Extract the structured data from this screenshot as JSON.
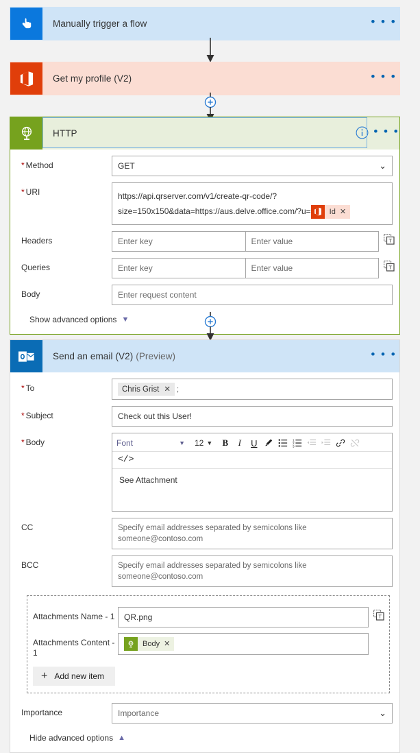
{
  "flow": {
    "trigger": {
      "title": "Manually trigger a flow",
      "icon": "hand-pointer-icon",
      "bg": "#cfe4f7",
      "icon_bg": "#0b78dd",
      "more_label": "• • •"
    },
    "profile": {
      "title": "Get my profile (V2)",
      "icon": "office365-icon",
      "bg": "#fbddd3",
      "icon_bg": "#e03e0a",
      "more_label": "• • •"
    },
    "http": {
      "title": "HTTP",
      "icon": "http-globe-icon",
      "accent": "#76a21e",
      "header_bg": "#e8efdc",
      "info_label": "i",
      "more_label": "• • •",
      "fields": {
        "method_label": "Method",
        "method_value": "GET",
        "uri_label": "URI",
        "uri_line1": "https://api.qrserver.com/v1/create-qr-code/?",
        "uri_line2": "size=150x150&data=https://aus.delve.office.com/?u=",
        "uri_token": "Id",
        "headers_label": "Headers",
        "queries_label": "Queries",
        "body_label": "Body",
        "key_placeholder": "Enter key",
        "value_placeholder": "Enter value",
        "body_placeholder": "Enter request content",
        "advanced_label": "Show advanced options"
      }
    },
    "email": {
      "title": "Send an email (V2)",
      "title_suffix": "(Preview)",
      "icon": "outlook-icon",
      "header_bg": "#cfe4f7",
      "icon_bg": "#0a6cb5",
      "more_label": "• • •",
      "fields": {
        "to_label": "To",
        "to_token": "Chris Grist",
        "to_separator": ";",
        "subject_label": "Subject",
        "subject_value": "Check out this User!",
        "body_label": "Body",
        "body_value": "See Attachment",
        "cc_label": "CC",
        "bcc_label": "BCC",
        "cc_placeholder": "Specify email addresses separated by semicolons like someone@contoso.com",
        "bcc_placeholder": "Specify email addresses separated by semicolons like someone@contoso.com",
        "importance_label": "Importance",
        "importance_placeholder": "Importance",
        "advanced_label": "Hide advanced options"
      },
      "editor": {
        "font_label": "Font",
        "size_label": "12",
        "bold": "B",
        "italic": "I",
        "underline": "U",
        "font_color": "font-color-icon",
        "bullet_list": "bulleted-list-icon",
        "numbered_list": "numbered-list-icon",
        "outdent": "outdent-icon",
        "indent": "indent-icon",
        "link": "link-icon",
        "unlink": "unlink-icon",
        "code_view": "</>"
      },
      "attachments": {
        "name_label": "Attachments Name - 1",
        "name_value": "QR.png",
        "content_label": "Attachments Content - 1",
        "content_token": "Body",
        "add_new_label": "Add new item",
        "add_new_icon": "plus-icon"
      }
    },
    "connectors": {
      "insert_label": "+",
      "insert_icon": "add-step-icon",
      "arrow_icon": "arrow-down-icon"
    }
  }
}
